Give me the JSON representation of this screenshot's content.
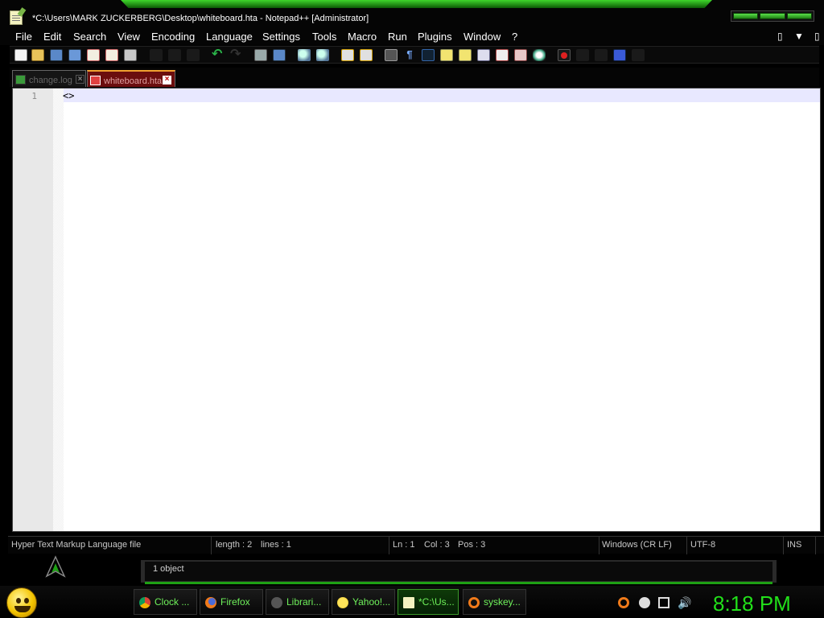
{
  "window": {
    "title": "*C:\\Users\\MARK ZUCKERBERG\\Desktop\\whiteboard.hta - Notepad++ [Administrator]"
  },
  "menu": {
    "items": [
      "File",
      "Edit",
      "Search",
      "View",
      "Encoding",
      "Language",
      "Settings",
      "Tools",
      "Macro",
      "Run",
      "Plugins",
      "Window",
      "?"
    ],
    "right": [
      "▯",
      "▼",
      "▯"
    ]
  },
  "toolbar": {
    "icons": [
      "new-file-icon",
      "open-file-icon",
      "save-icon",
      "save-all-icon",
      "close-icon",
      "close-all-icon",
      "print-icon",
      "cut-icon",
      "copy-icon",
      "paste-icon",
      "undo-icon",
      "redo-icon",
      "find-icon",
      "replace-icon",
      "zoom-in-icon",
      "zoom-out-icon",
      "sync-vertical-icon",
      "sync-horizontal-icon",
      "word-wrap-icon",
      "show-all-chars-icon",
      "indent-guide-icon",
      "lang-define-icon",
      "doc-map-icon",
      "function-list-icon",
      "folder-workspace-icon",
      "monitoring-icon",
      "record-macro-icon",
      "stop-macro-icon",
      "play-macro-icon",
      "run-macro-multiple-icon",
      "save-macro-icon"
    ]
  },
  "tabs": [
    {
      "label": "change.log",
      "active": false
    },
    {
      "label": "whiteboard.hta",
      "active": true
    }
  ],
  "editor": {
    "line_numbers": [
      "1"
    ],
    "lines": [
      "<>"
    ]
  },
  "status": {
    "filetype": "Hyper Text Markup Language file",
    "length": "length : 2",
    "lines": "lines : 1",
    "ln": "Ln : 1",
    "col": "Col : 3",
    "pos": "Pos : 3",
    "eol": "Windows (CR LF)",
    "encoding": "UTF-8",
    "mode": "INS"
  },
  "explorer": {
    "object_count": "1 object"
  },
  "taskbar": {
    "buttons": [
      {
        "label": "Clock ...",
        "icon": "chrome-icon"
      },
      {
        "label": "Firefox",
        "icon": "firefox-icon"
      },
      {
        "label": "Librari...",
        "icon": "libraries-icon"
      },
      {
        "label": "Yahoo!...",
        "icon": "yahoo-messenger-icon"
      },
      {
        "label": "*C:\\Us...",
        "icon": "notepadpp-icon"
      },
      {
        "label": "syskey...",
        "icon": "search-icon"
      }
    ],
    "clock": "8:18 PM"
  },
  "colors": {
    "accent_green": "#22e01a",
    "active_tab": "#6b0e0e",
    "background": "#000000"
  }
}
